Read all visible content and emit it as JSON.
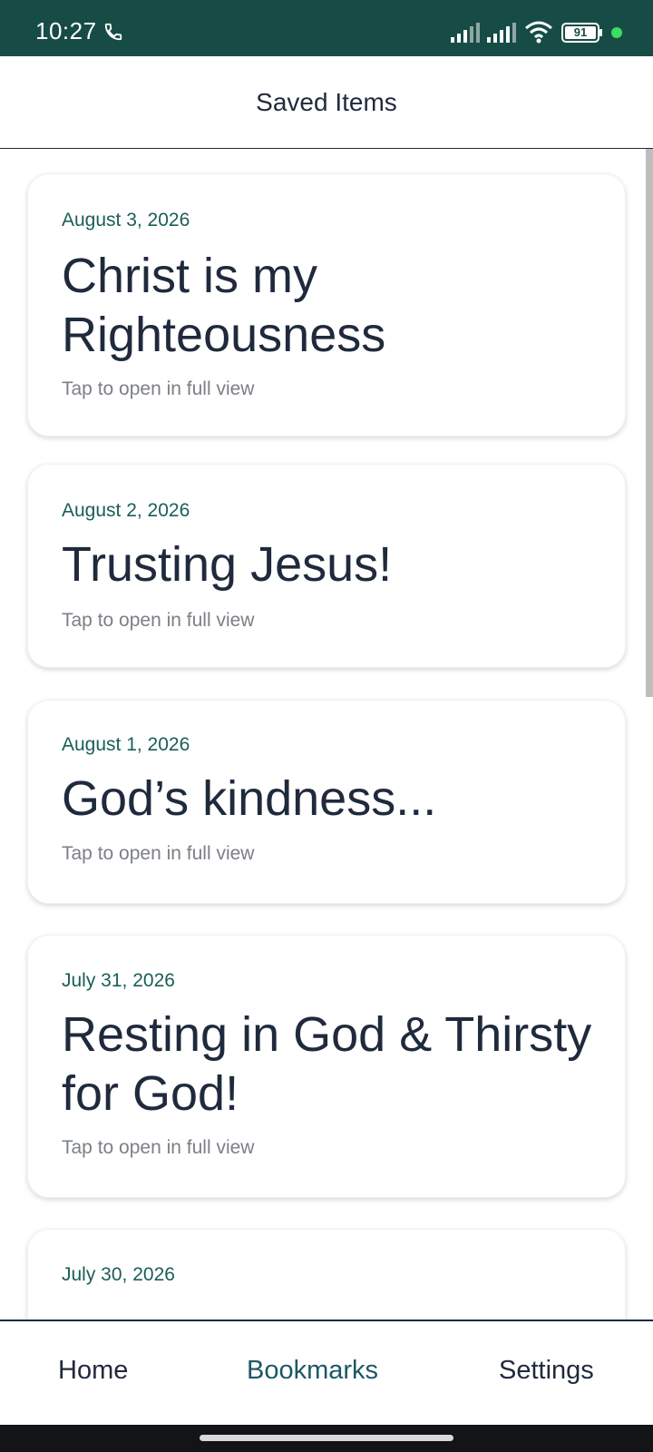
{
  "status_bar": {
    "time": "10:27",
    "battery_level": "91",
    "colors": {
      "background": "#174c46",
      "indicator_dot": "#3ddc63"
    },
    "icons": [
      "phone-icon",
      "cellular-signal-icon",
      "cellular-signal-icon",
      "wifi-icon",
      "battery-icon"
    ]
  },
  "header": {
    "title": "Saved Items"
  },
  "cards": [
    {
      "date": "August 3, 2026",
      "title": "Christ is my Righteousness",
      "hint": "Tap to open in full view"
    },
    {
      "date": "August 2, 2026",
      "title": "Trusting Jesus!",
      "hint": "Tap to open in full view"
    },
    {
      "date": "August 1, 2026",
      "title": "God’s kindness...",
      "hint": "Tap to open in full view"
    },
    {
      "date": "July 31, 2026",
      "title": "Resting in God & Thirsty for God!",
      "hint": "Tap to open in full view"
    },
    {
      "date": "July 30, 2026"
    }
  ],
  "bottom_nav": {
    "items": [
      {
        "label": "Home",
        "active": false
      },
      {
        "label": "Bookmarks",
        "active": true
      },
      {
        "label": "Settings",
        "active": false
      }
    ]
  },
  "colors": {
    "accent": "#1d5865",
    "date_text": "#1b5e58",
    "title_text": "#1f2a3c",
    "hint_text": "#7b7f86"
  }
}
